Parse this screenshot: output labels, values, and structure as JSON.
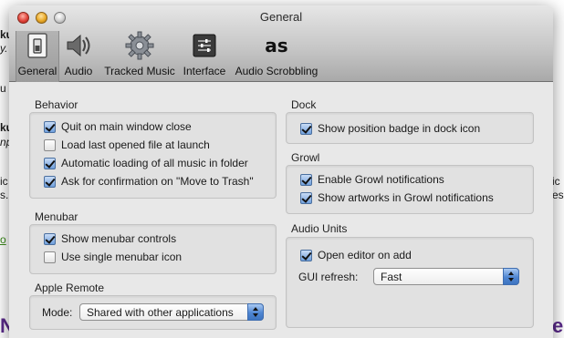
{
  "window": {
    "title": "General"
  },
  "toolbar": {
    "items": [
      {
        "label": "General",
        "icon": "switch-icon",
        "selected": true
      },
      {
        "label": "Audio",
        "icon": "speaker-icon",
        "selected": false
      },
      {
        "label": "Tracked Music",
        "icon": "gear-icon",
        "selected": false
      },
      {
        "label": "Interface",
        "icon": "sliders-icon",
        "selected": false
      },
      {
        "label": "Audio Scrobbling",
        "icon": "lastfm-icon",
        "selected": false
      }
    ]
  },
  "behavior": {
    "title": "Behavior",
    "options": [
      {
        "label": "Quit on main window close",
        "checked": true
      },
      {
        "label": "Load last opened file at launch",
        "checked": false
      },
      {
        "label": "Automatic loading of all music in folder",
        "checked": true
      },
      {
        "label": "Ask for confirmation on \"Move to Trash\"",
        "checked": true
      }
    ]
  },
  "menubar": {
    "title": "Menubar",
    "options": [
      {
        "label": "Show menubar controls",
        "checked": true
      },
      {
        "label": "Use single menubar icon",
        "checked": false
      }
    ]
  },
  "apple_remote": {
    "title": "Apple Remote",
    "mode_label": "Mode:",
    "mode_value": "Shared with other applications"
  },
  "dock": {
    "title": "Dock",
    "options": [
      {
        "label": "Show position badge in dock icon",
        "checked": true
      }
    ]
  },
  "growl": {
    "title": "Growl",
    "options": [
      {
        "label": "Enable Growl notifications",
        "checked": true
      },
      {
        "label": "Show artworks in Growl notifications",
        "checked": true
      }
    ]
  },
  "audio_units": {
    "title": "Audio Units",
    "options": [
      {
        "label": "Open editor on add",
        "checked": true
      }
    ],
    "gui_refresh_label": "GUI refresh:",
    "gui_refresh_value": "Fast"
  },
  "background_fragments": {
    "left": [
      "ku",
      "y.",
      "u",
      "ku",
      "np",
      "ic",
      "s.",
      "o",
      "N"
    ],
    "right": [
      "ic",
      "es",
      "e"
    ]
  },
  "colors": {
    "accent": "#4f86d2",
    "window_bg": "#e8e8e8"
  }
}
